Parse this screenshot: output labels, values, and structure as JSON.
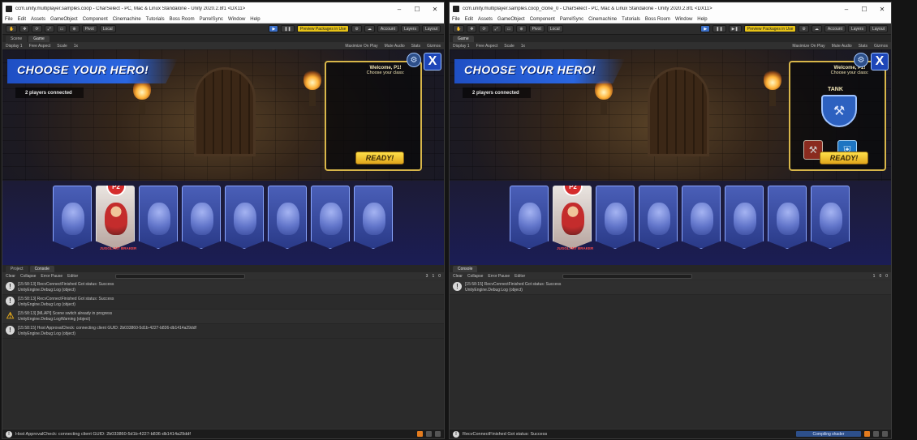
{
  "windows": [
    {
      "title": "ccm.unity.multiplayer.samples.coop - CharSelect - PC, Mac & Linux Standalone - Unity 2020.2.8f1 <DX11>",
      "menu": [
        "File",
        "Edit",
        "Assets",
        "GameObject",
        "Component",
        "Cinemachine",
        "Tutorials",
        "Boss Room",
        "ParrelSync",
        "Window",
        "Help"
      ],
      "toolbar": {
        "pivot": "Pivot",
        "local": "Local",
        "preview": "Preview Packages in Use",
        "account": "Account",
        "layers": "Layers",
        "layout": "Layout"
      },
      "tabs": [
        "Scene",
        "Game"
      ],
      "gamebar": {
        "display": "Display 1",
        "aspect": "Free Aspect",
        "scale_label": "Scale",
        "scale_value": "1x",
        "max": "Maximize On Play",
        "mute": "Mute Audio",
        "stats": "Stats",
        "gizmos": "Gizmos"
      },
      "game": {
        "banner": "CHOOSE YOUR HERO!",
        "connected": "2 players connected",
        "welcome": "Welcome, P1!",
        "choose": "Choose your class:",
        "class_name": "",
        "ready": "READY!",
        "badge": "P2",
        "seat_label": "JUGGLANT BRAKER"
      },
      "console": {
        "tabs": [
          "Project",
          "Console"
        ],
        "tools": [
          "Clear",
          "Collapse",
          "Error Pause",
          "Editor"
        ],
        "counts": [
          "3",
          "1",
          "0"
        ],
        "logs": [
          {
            "type": "info",
            "line1": "[15:58:13] RecvConnectFinished Got status: Success",
            "line2": "UnityEngine.Debug:Log (object)"
          },
          {
            "type": "info",
            "line1": "[15:58:13] RecvConnectFinished Got status: Success",
            "line2": "UnityEngine.Debug:Log (object)"
          },
          {
            "type": "warn",
            "line1": "[15:58:13] [MLAPI] Scene switch already in progress",
            "line2": "UnityEngine.Debug:LogWarning (object)"
          },
          {
            "type": "info",
            "line1": "[15:58:15] Host ApprovalCheck: connecting client GUID: 2b033860-5d1b-4227-b836-db1414a29ddf",
            "line2": "UnityEngine.Debug:Log (object)"
          }
        ]
      },
      "status": "Host ApprovalCheck: connecting client GUID: 2b033860-5d1b-4227-b836-db1414a29ddf",
      "compiling": ""
    },
    {
      "title": "ccm.unity.multiplayer.samples.coop_clone_0 - CharSelect - PC, Mac & Linux Standalone - Unity 2020.2.8f1 <DX11>",
      "menu": [
        "File",
        "Edit",
        "Assets",
        "GameObject",
        "Component",
        "ParrelSync",
        "Cinemachine",
        "Tutorials",
        "Boss Room",
        "Window",
        "Help"
      ],
      "toolbar": {
        "pivot": "Pivot",
        "local": "Local",
        "preview": "Preview Packages in Use",
        "account": "Account",
        "layers": "Layers",
        "layout": "Layout"
      },
      "tabs": [
        "Game"
      ],
      "gamebar": {
        "display": "Display 1",
        "aspect": "Free Aspect",
        "scale_label": "Scale",
        "scale_value": "1x",
        "max": "Maximize On Play",
        "mute": "Mute Audio",
        "stats": "Stats",
        "gizmos": "Gizmos"
      },
      "game": {
        "banner": "CHOOSE YOUR HERO!",
        "connected": "2 players connected",
        "welcome": "Welcome, P2!",
        "choose": "Choose your class:",
        "class_name": "TANK",
        "ready": "READY!",
        "badge": "P2",
        "seat_label": "JUGGLANT BRAKER"
      },
      "console": {
        "tabs": [
          "Console"
        ],
        "tools": [
          "Clear",
          "Collapse",
          "Error Pause",
          "Editor"
        ],
        "counts": [
          "1",
          "0",
          "0"
        ],
        "logs": [
          {
            "type": "info",
            "line1": "[15:58:15] RecvConnectFinished Got status: Success",
            "line2": "UnityEngine.Debug:Log (object)"
          }
        ]
      },
      "status": "RecvConnectFinished Got status: Success",
      "compiling": "Compiling shader"
    }
  ]
}
